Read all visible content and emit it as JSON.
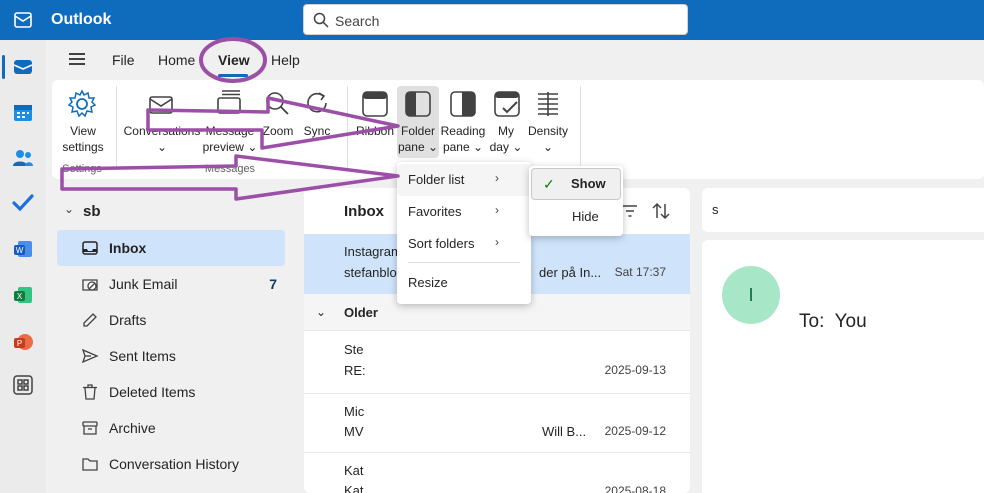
{
  "app": {
    "title": "Outlook",
    "brand_color": "#0f6cbd"
  },
  "search": {
    "placeholder": "Search"
  },
  "rail": {
    "items": [
      "mail-icon",
      "calendar-icon",
      "people-icon",
      "todo-icon",
      "word-icon",
      "excel-icon",
      "powerpoint-icon",
      "apps-icon"
    ]
  },
  "menu": {
    "tabs": [
      "File",
      "Home",
      "View",
      "Help"
    ],
    "active": "View"
  },
  "ribbon": {
    "view_settings": [
      "View",
      "settings"
    ],
    "group_settings": "Settings",
    "conversations": "Conversations",
    "message_preview": [
      "Message",
      "preview"
    ],
    "zoom": "Zoom",
    "sync": "Sync",
    "group_messages": "Messages",
    "ribbon": "Ribbon",
    "folder_pane": [
      "Folder",
      "pane"
    ],
    "reading_pane": [
      "Reading",
      "pane"
    ],
    "my_day": [
      "My",
      "day"
    ],
    "density": "Density"
  },
  "folder_pane_menu": {
    "items": [
      {
        "label": "Folder list",
        "submenu": true
      },
      {
        "label": "Favorites",
        "submenu": true
      },
      {
        "label": "Sort folders",
        "submenu": true
      },
      {
        "label": "Resize",
        "submenu": false
      }
    ]
  },
  "folder_list_submenu": {
    "show": "Show",
    "hide": "Hide",
    "checked": "Show"
  },
  "folders": {
    "account": "sb",
    "items": [
      {
        "label": "Inbox",
        "icon": "inbox-icon",
        "selected": true,
        "count": ""
      },
      {
        "label": "Junk Email",
        "icon": "junk-icon",
        "selected": false,
        "count": "7"
      },
      {
        "label": "Drafts",
        "icon": "drafts-icon",
        "selected": false,
        "count": ""
      },
      {
        "label": "Sent Items",
        "icon": "send-icon",
        "selected": false,
        "count": ""
      },
      {
        "label": "Deleted Items",
        "icon": "trash-icon",
        "selected": false,
        "count": ""
      },
      {
        "label": "Archive",
        "icon": "archive-icon",
        "selected": false,
        "count": ""
      },
      {
        "label": "Conversation History",
        "icon": "folder-icon",
        "selected": false,
        "count": ""
      }
    ]
  },
  "messages": {
    "title": "Inbox",
    "selected": {
      "sender": "Instagram",
      "line2_left": "stefanblo",
      "line2_right": "der på In...",
      "date": "Sat 17:37"
    },
    "group": "Older",
    "items": [
      {
        "line1": "Ste",
        "line2": "RE:",
        "date": "2025-09-13"
      },
      {
        "line1": "Mic",
        "line2": "MV",
        "line2_right": "Will B...",
        "date": "2025-09-12"
      },
      {
        "line1": "Kat",
        "line2": "Kat",
        "date": "2025-08-18"
      }
    ]
  },
  "reading": {
    "search_fragment": "s",
    "avatar_initial": "I",
    "to_label": "To:",
    "to_value": "You"
  }
}
